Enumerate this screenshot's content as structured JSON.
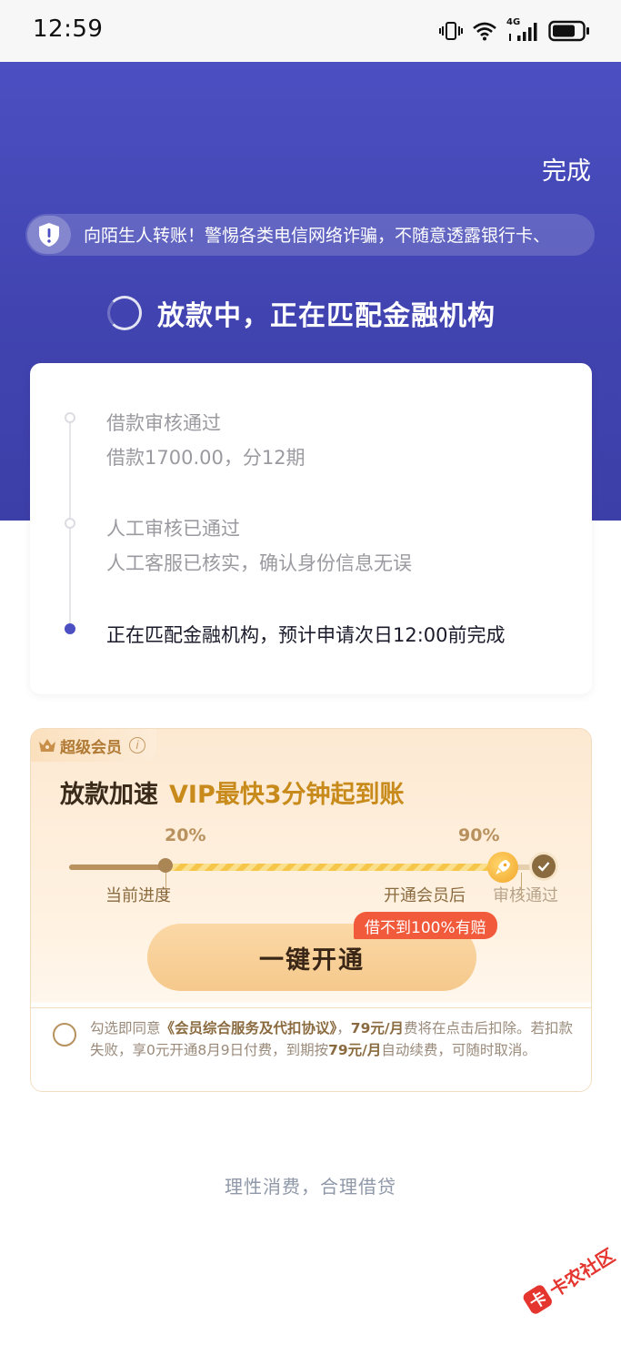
{
  "status_bar": {
    "time": "12:59",
    "network_label": "4G",
    "icons": [
      "vibrate-icon",
      "wifi-icon",
      "cellular-signal-icon",
      "battery-icon"
    ]
  },
  "header": {
    "done_label": "完成"
  },
  "notice": {
    "icon": "shield-alert-icon",
    "text": "向陌生人转账！警惕各类电信网络诈骗，不随意透露银行卡、"
  },
  "loading": {
    "title": "放款中，正在匹配金融机构"
  },
  "steps": {
    "step1_title": "借款审核通过",
    "step1_desc": "借款1700.00，分12期",
    "step2_title": "人工审核已通过",
    "step2_desc": "人工客服已核实，确认身份信息无误",
    "step3_title": "正在匹配金融机构，预计申请次日12:00前完成"
  },
  "vip": {
    "badge": "超级会员",
    "info_glyph": "i",
    "headline_a": "放款加速",
    "headline_b": "VIP最快3分钟起到账",
    "progress_current_pct": "20%",
    "progress_vip_pct": "90%",
    "progress_current": 0.2,
    "progress_vip": 0.9,
    "label_current": "当前进度",
    "label_vip": "开通会员后",
    "label_done": "审核通过",
    "open_button": "一键开通",
    "compensate_tag": "借不到100%有赔",
    "agree_pre": "勾选即同意",
    "agree_link": "《会员综合服务及代扣协议》",
    "agree_mid1": "，",
    "agree_price1": "79元/月",
    "agree_mid2": "费将在点击后扣除。若扣款失败，享0元开通8月9日付费，到期按",
    "agree_price2": "79元/月",
    "agree_end": "自动续费，可随时取消。"
  },
  "footer": {
    "slogan": "理性消费，合理借贷"
  },
  "watermark": {
    "logo_char": "卡",
    "text": "卡农社区"
  },
  "colors": {
    "hero": "#4144b0",
    "accent": "#4b4fc1",
    "vip_gold": "#b8915e",
    "tag_red": "#f25a3c"
  }
}
